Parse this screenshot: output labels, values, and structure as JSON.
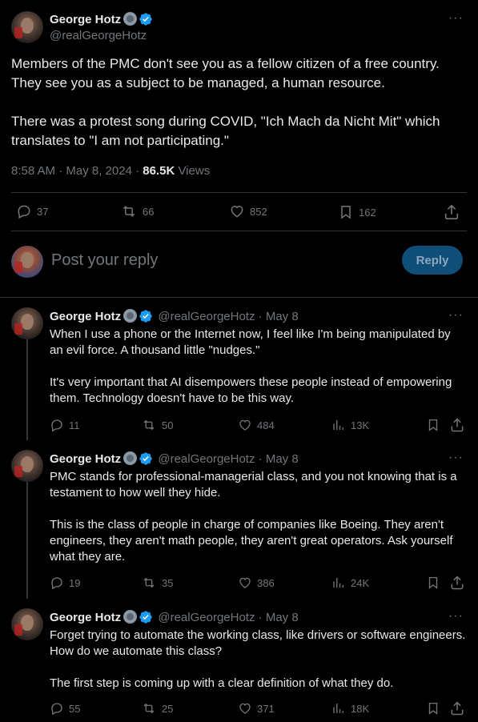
{
  "main_tweet": {
    "author": "George Hotz",
    "handle": "@realGeorgeHotz",
    "paragraphs": [
      "Members of the PMC don't see you as a fellow citizen of a free country. They see you as a subject to be managed, a human resource.",
      "There was a protest song during COVID, \"Ich Mach da Nicht Mit\" which translates to \"I am not participating.\""
    ],
    "time": "8:58 AM · May 8, 2024 · ",
    "views_count": "86.5K",
    "views_label": " Views",
    "replies": "37",
    "reposts": "66",
    "likes": "852",
    "bookmarks": "162"
  },
  "reply_box": {
    "placeholder": "Post your reply",
    "button": "Reply"
  },
  "thread": [
    {
      "author": "George Hotz",
      "handle": "@realGeorgeHotz",
      "date": "· May 8",
      "paragraphs": [
        "When I use a phone or the Internet now, I feel like I'm being manipulated by an evil force. A thousand little \"nudges.\"",
        "It's very important that AI disempowers these people instead of empowering them. Technology doesn't have to be this way."
      ],
      "replies": "11",
      "reposts": "50",
      "likes": "484",
      "views": "13K"
    },
    {
      "author": "George Hotz",
      "handle": "@realGeorgeHotz",
      "date": "· May 8",
      "paragraphs": [
        "PMC stands for professional-managerial class, and you not knowing that is a testament to how well they hide.",
        "This is the class of people in charge of companies like Boeing. They aren't engineers, they aren't math people, they aren't great operators. Ask yourself what they are."
      ],
      "replies": "19",
      "reposts": "35",
      "likes": "386",
      "views": "24K"
    },
    {
      "author": "George Hotz",
      "handle": "@realGeorgeHotz",
      "date": "· May 8",
      "paragraphs": [
        "Forget trying to automate the working class, like drivers or software engineers. How do we automate this class?",
        "The first step is coming up with a clear definition of what they do."
      ],
      "replies": "55",
      "reposts": "25",
      "likes": "371",
      "views": "18K"
    }
  ],
  "colors": {
    "background": "#000000",
    "text": "#e7e9ea",
    "muted": "#71767b",
    "verified": "#1d9bf0",
    "reply_button": "#0f4e78"
  }
}
